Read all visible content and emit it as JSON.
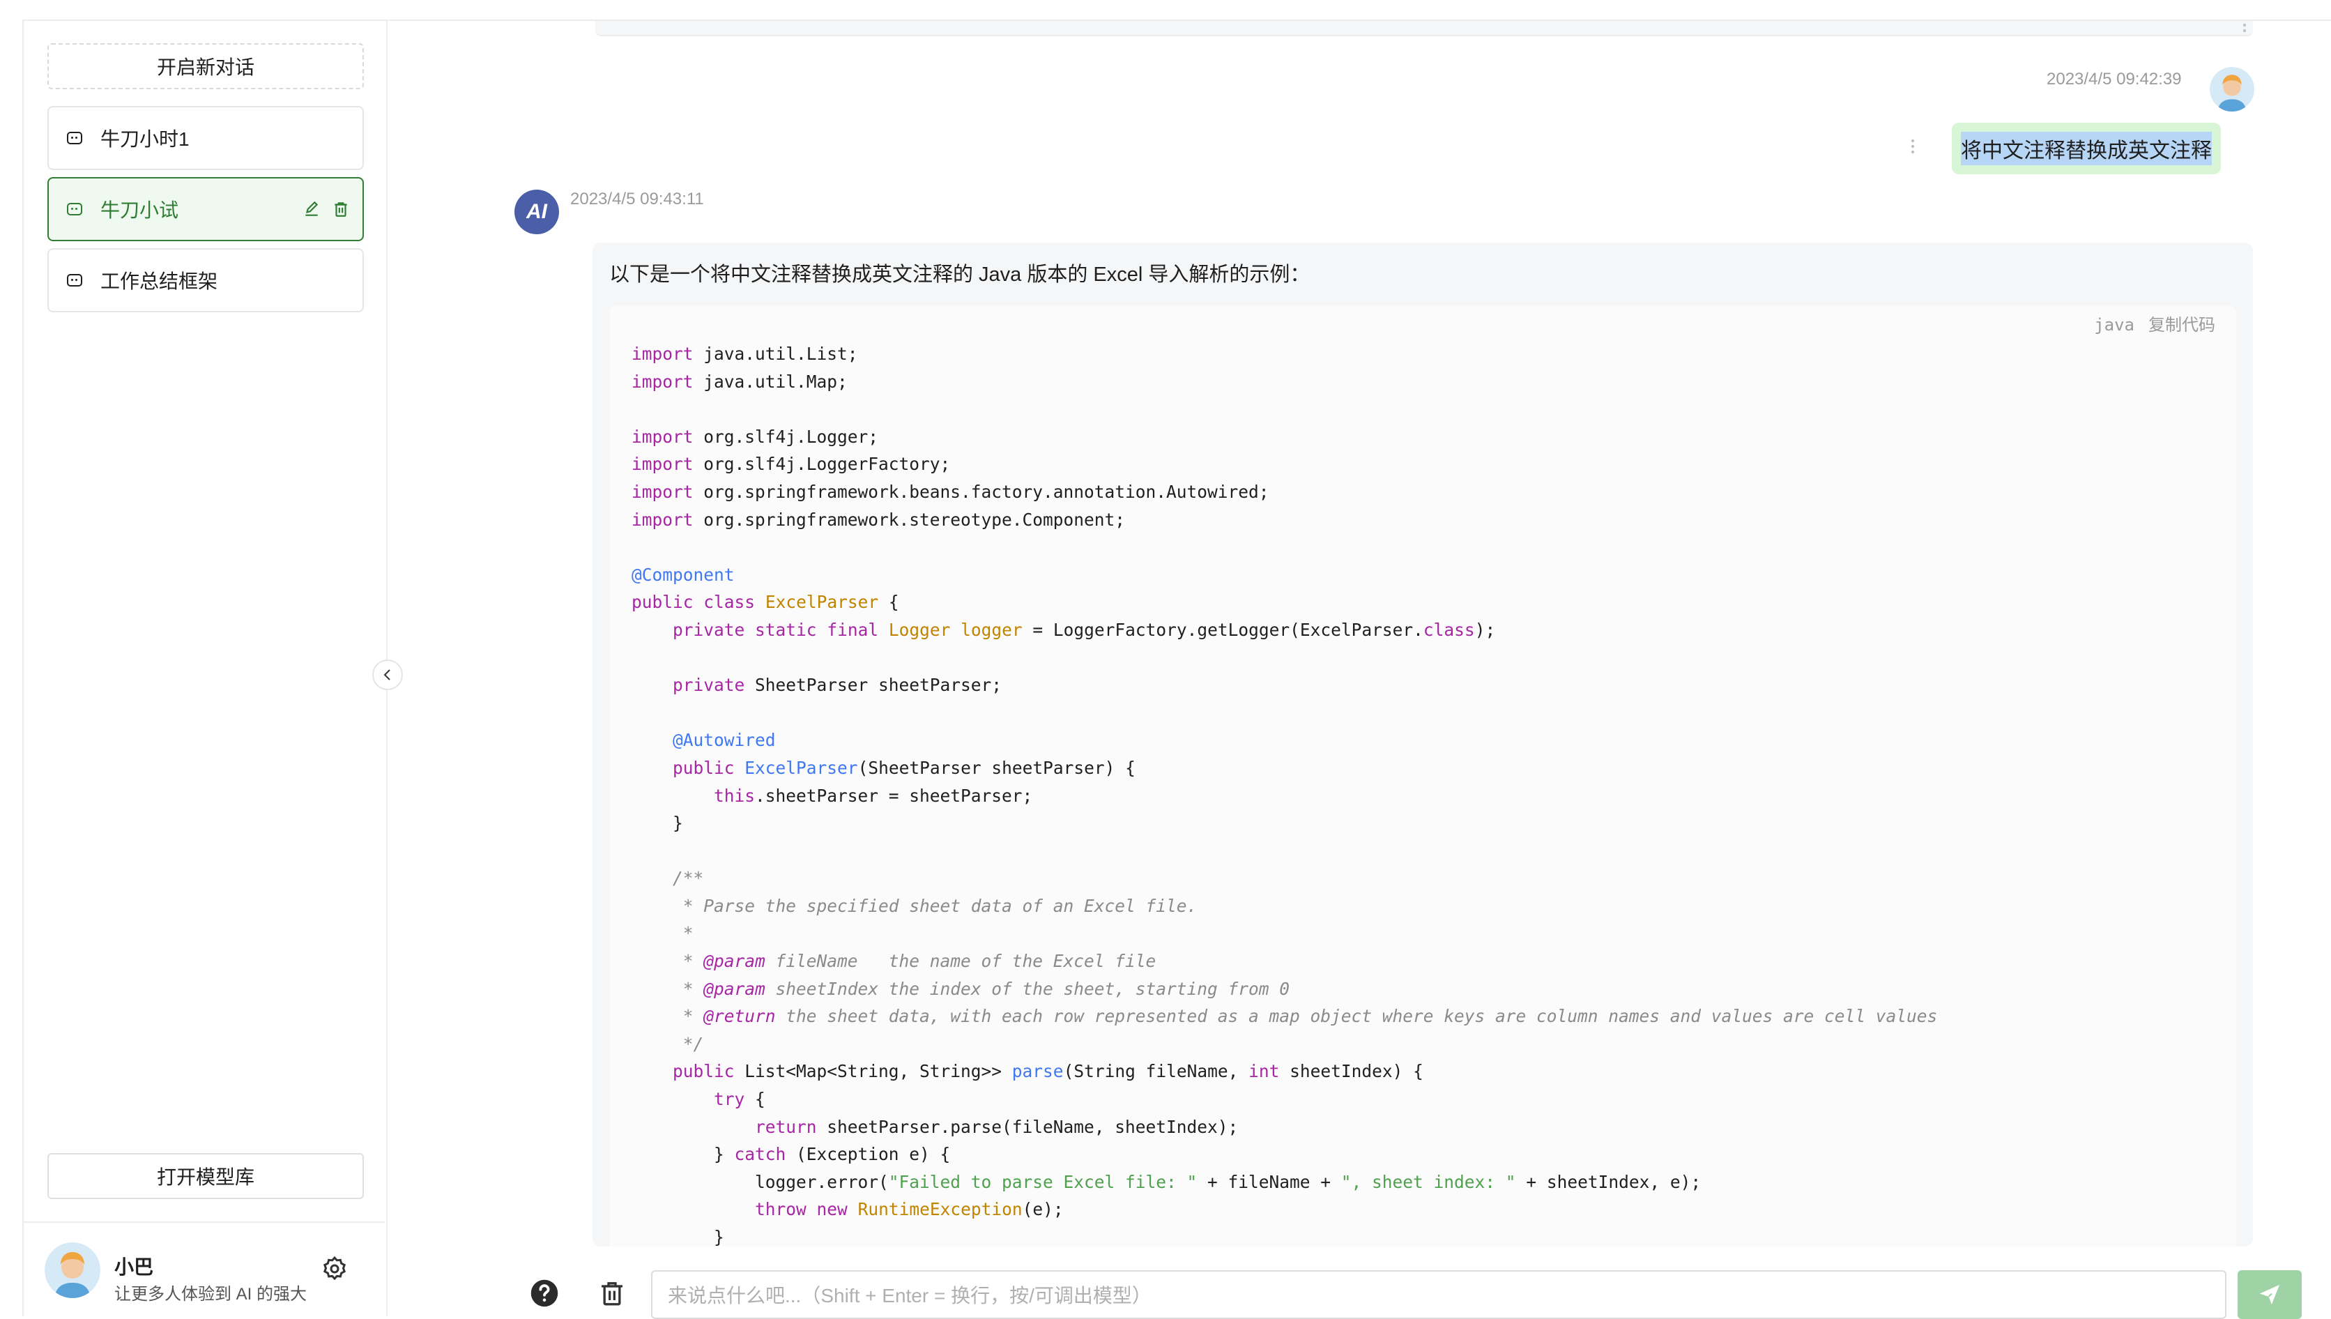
{
  "sidebar": {
    "new_chat_label": "开启新对话",
    "sessions": [
      {
        "label": "牛刀小时1"
      },
      {
        "label": "牛刀小试"
      },
      {
        "label": "工作总结框架"
      }
    ],
    "model_library_label": "打开模型库",
    "user": {
      "name": "小巴",
      "description": "让更多人体验到 AI 的强大"
    }
  },
  "chat": {
    "user_message": {
      "time": "2023/4/5 09:42:39",
      "text": "将中文注释替换成英文注释"
    },
    "ai_message": {
      "time": "2023/4/5 09:43:11",
      "avatar_text": "AI",
      "intro": "以下是一个将中文注释替换成英文注释的 Java 版本的 Excel 导入解析的示例：",
      "code_language": "java",
      "copy_label": "复制代码",
      "code_lines": [
        "import java.util.List;",
        "import java.util.Map;",
        "",
        "import org.slf4j.Logger;",
        "import org.slf4j.LoggerFactory;",
        "import org.springframework.beans.factory.annotation.Autowired;",
        "import org.springframework.stereotype.Component;",
        "",
        "@Component",
        "public class ExcelParser {",
        "    private static final Logger logger = LoggerFactory.getLogger(ExcelParser.class);",
        "",
        "    private SheetParser sheetParser;",
        "",
        "    @Autowired",
        "    public ExcelParser(SheetParser sheetParser) {",
        "        this.sheetParser = sheetParser;",
        "    }",
        "",
        "    /**",
        "     * Parse the specified sheet data of an Excel file.",
        "     *",
        "     * @param fileName   the name of the Excel file",
        "     * @param sheetIndex the index of the sheet, starting from 0",
        "     * @return the sheet data, with each row represented as a map object where keys are column names and values are cell values",
        "     */",
        "    public List<Map<String, String>> parse(String fileName, int sheetIndex) {",
        "        try {",
        "            return sheetParser.parse(fileName, sheetIndex);",
        "        } catch (Exception e) {",
        "            logger.error(\"Failed to parse Excel file: \" + fileName + \", sheet index: \" + sheetIndex, e);",
        "            throw new RuntimeException(e);",
        "        }"
      ]
    }
  },
  "input": {
    "placeholder": "来说点什么吧...（Shift + Enter = 换行，按/可调出模型）"
  },
  "icons": {
    "session": "chat-bubble-icon",
    "edit": "edit-icon",
    "delete": "trash-icon",
    "settings": "gear-icon",
    "collapse": "chevron-left-icon",
    "help": "question-icon",
    "clear": "trash-icon",
    "send": "send-icon"
  },
  "colors": {
    "accent": "#2e7d32",
    "active_session_bg": "#f0f9f0",
    "user_bubble": "#d8f5d5",
    "send_button": "#9fd3a6"
  }
}
